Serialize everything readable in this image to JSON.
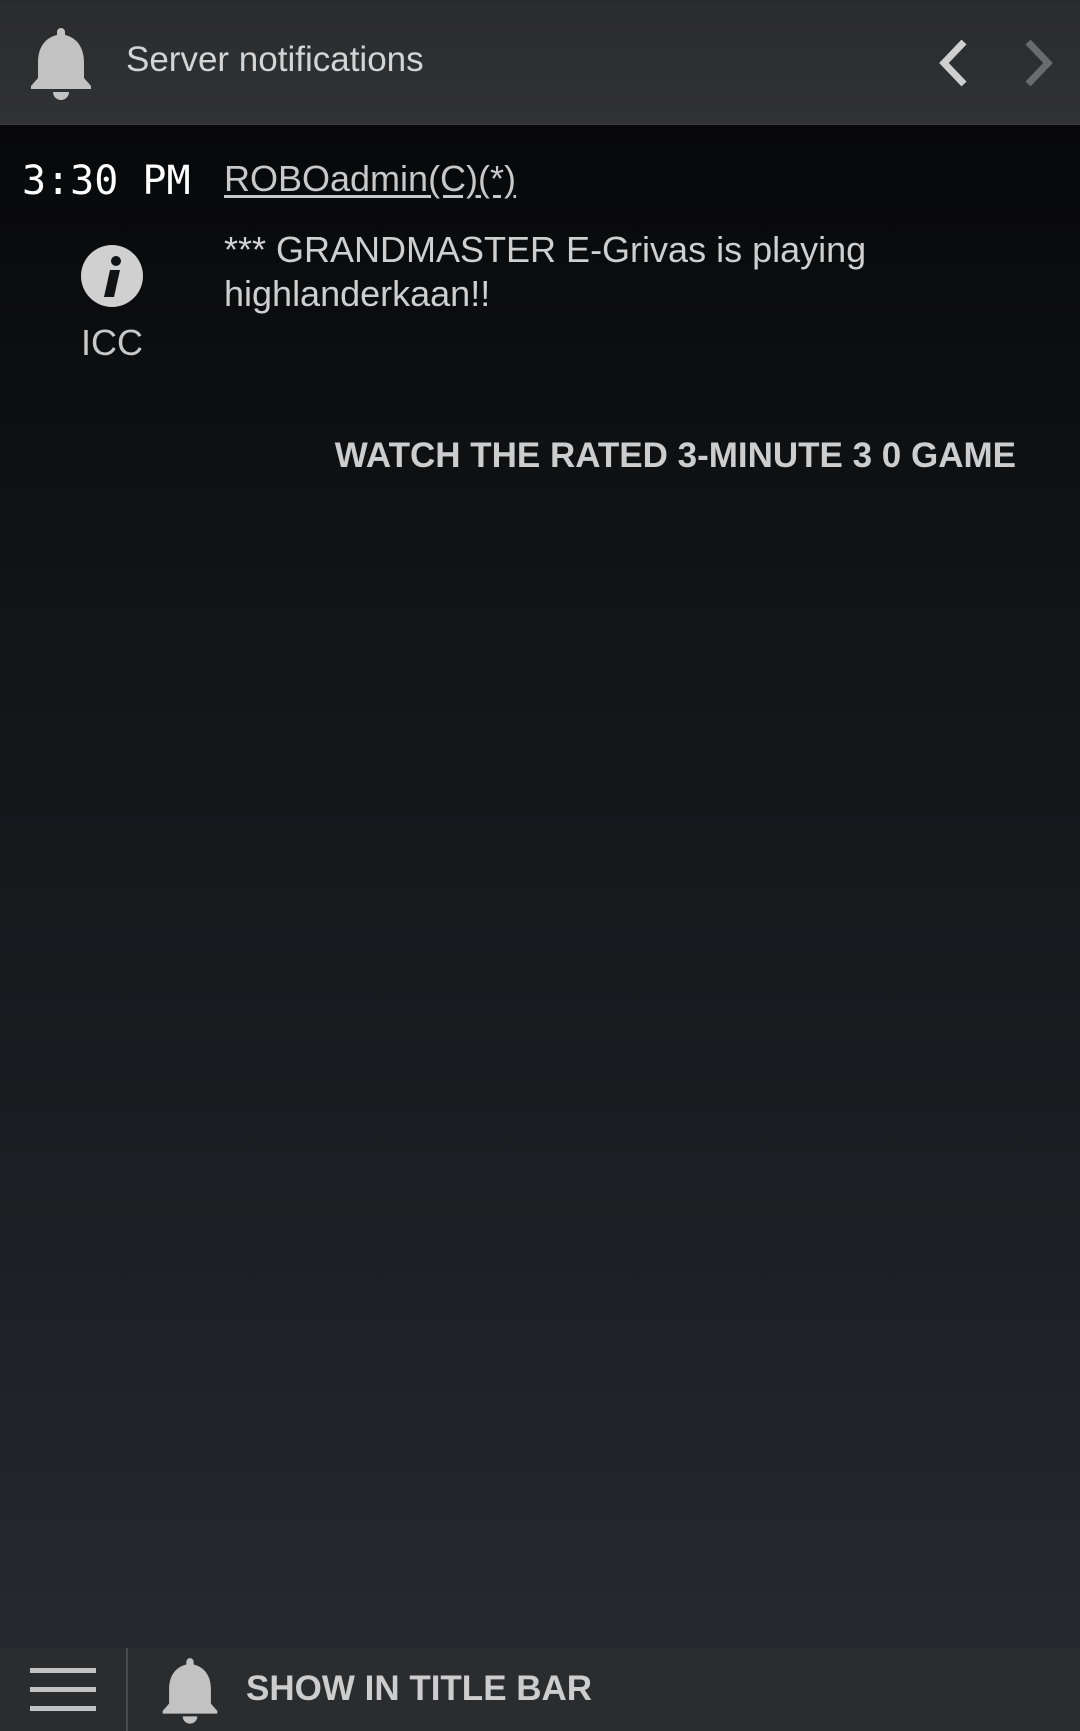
{
  "header": {
    "title": "Server notifications",
    "bell_icon": "bell-icon",
    "back_icon": "chevron-left-icon",
    "forward_icon": "chevron-right-icon"
  },
  "message": {
    "time": "3:30 PM",
    "sender": "ROBOadmin(C)(*)",
    "icon": "info-icon",
    "source": "ICC",
    "text": "*** GRANDMASTER E-Grivas is playing highlanderkaan!!",
    "action": "WATCH THE RATED 3-MINUTE 3 0 GAME"
  },
  "footer": {
    "menu_icon": "hamburger-menu-icon",
    "bell_icon": "bell-icon",
    "label": "SHOW IN TITLE BAR"
  },
  "colors": {
    "topbar": "#2f3032",
    "bottombar": "#2b2c2e",
    "text": "#d4d4d4",
    "time": "#ffffff"
  }
}
